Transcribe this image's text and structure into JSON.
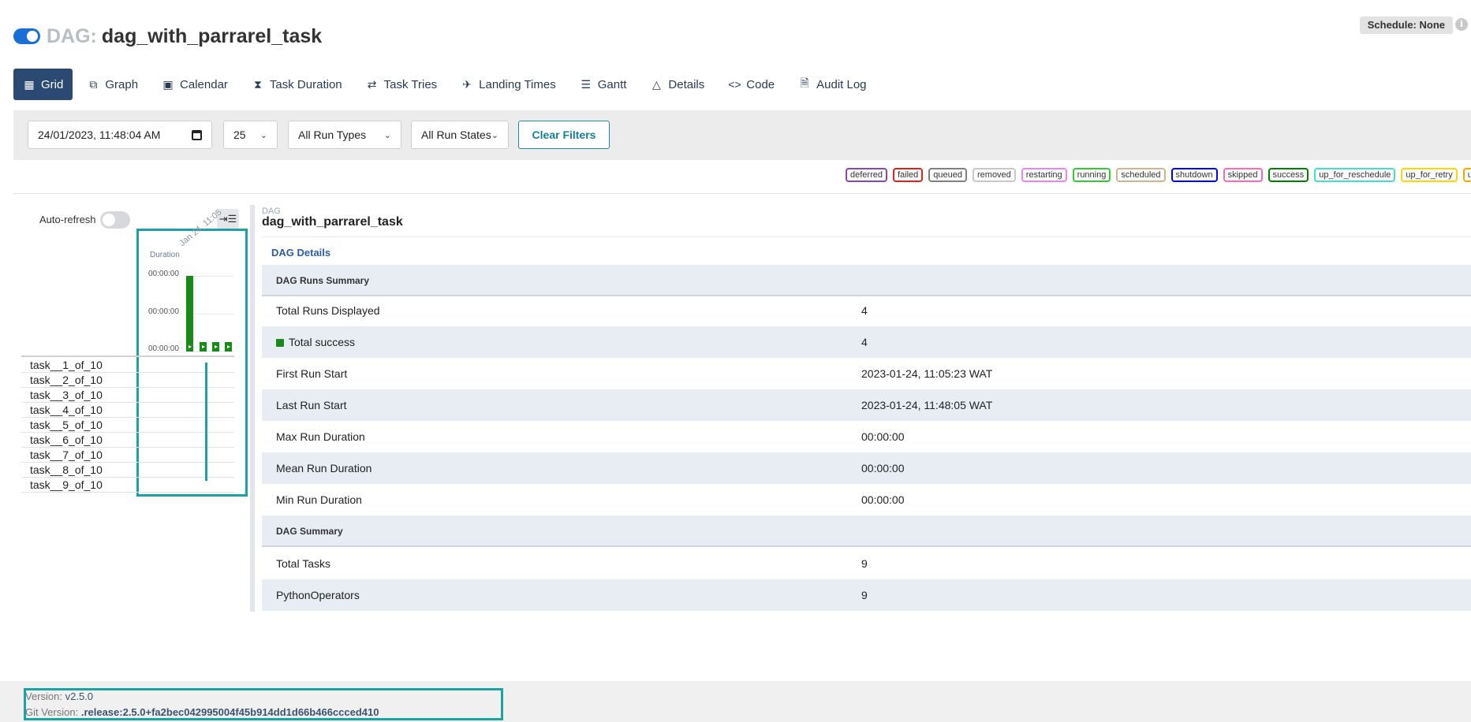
{
  "header": {
    "dag_prefix": "DAG:",
    "dag_id": "dag_with_parrarel_task",
    "schedule": "Schedule: None",
    "info_glyph": "i"
  },
  "tabs": [
    {
      "label": "Grid",
      "icon": "grid-icon"
    },
    {
      "label": "Graph",
      "icon": "graph-icon"
    },
    {
      "label": "Calendar",
      "icon": "calendar-icon"
    },
    {
      "label": "Task Duration",
      "icon": "hourglass-icon"
    },
    {
      "label": "Task Tries",
      "icon": "retry-icon"
    },
    {
      "label": "Landing Times",
      "icon": "plane-icon"
    },
    {
      "label": "Gantt",
      "icon": "gantt-icon"
    },
    {
      "label": "Details",
      "icon": "warning-icon"
    },
    {
      "label": "Code",
      "icon": "code-icon"
    },
    {
      "label": "Audit Log",
      "icon": "file-icon"
    }
  ],
  "filters": {
    "datetime": "24/01/2023, 11:48:04 AM",
    "num_runs": "25",
    "run_types": "All Run Types",
    "run_states": "All Run States",
    "clear_label": "Clear Filters"
  },
  "legend": [
    {
      "label": "deferred",
      "color": "#8e44ad"
    },
    {
      "label": "failed",
      "color": "#e02020"
    },
    {
      "label": "queued",
      "color": "#808080"
    },
    {
      "label": "removed",
      "color": "#c8c8c8"
    },
    {
      "label": "restarting",
      "color": "#ee82ee"
    },
    {
      "label": "running",
      "color": "#32cd32"
    },
    {
      "label": "scheduled",
      "color": "#d2b48c"
    },
    {
      "label": "shutdown",
      "color": "#0000ff"
    },
    {
      "label": "skipped",
      "color": "#ff69b4"
    },
    {
      "label": "success",
      "color": "#008000"
    },
    {
      "label": "up_for_reschedule",
      "color": "#40e0d0"
    },
    {
      "label": "up_for_retry",
      "color": "#ffd700"
    },
    {
      "label": "upstream_failed",
      "color": "#ffa500"
    }
  ],
  "grid": {
    "auto_refresh_label": "Auto-refresh",
    "auto_refresh_on": false,
    "collapse_glyph": "⇥☰",
    "duration_label": "Duration",
    "run_date_label": "Jan 24, 11:05",
    "duration_ticks": [
      "00:00:00",
      "00:00:00",
      "00:00:00"
    ],
    "run_durations_fraction": [
      1.0,
      0.05,
      0.05,
      0.05
    ],
    "tasks": [
      "task__1_of_10",
      "task__2_of_10",
      "task__3_of_10",
      "task__4_of_10",
      "task__5_of_10",
      "task__6_of_10",
      "task__7_of_10",
      "task__8_of_10",
      "task__9_of_10"
    ]
  },
  "details": {
    "dag_label": "DAG",
    "dag_id": "dag_with_parrarel_task",
    "link": "DAG Details",
    "runs_summary_header": "DAG Runs Summary",
    "runs_summary": [
      {
        "label": "Total Runs Displayed",
        "value": "4"
      },
      {
        "label": "Total success",
        "value": "4"
      },
      {
        "label": "First Run Start",
        "value": "2023-01-24, 11:05:23 WAT"
      },
      {
        "label": "Last Run Start",
        "value": "2023-01-24, 11:48:05 WAT"
      },
      {
        "label": "Max Run Duration",
        "value": "00:00:00"
      },
      {
        "label": "Mean Run Duration",
        "value": "00:00:00"
      },
      {
        "label": "Min Run Duration",
        "value": "00:00:00"
      }
    ],
    "dag_summary_header": "DAG Summary",
    "dag_summary": [
      {
        "label": "Total Tasks",
        "value": "9"
      },
      {
        "label": "PythonOperators",
        "value": "9"
      }
    ]
  },
  "footer": {
    "version_label": "Version:",
    "version": "v2.5.0",
    "git_label": "Git Version:",
    "git_version": ".release:2.5.0+fa2bec042995004f45b914dd1d66b466ccced410"
  }
}
